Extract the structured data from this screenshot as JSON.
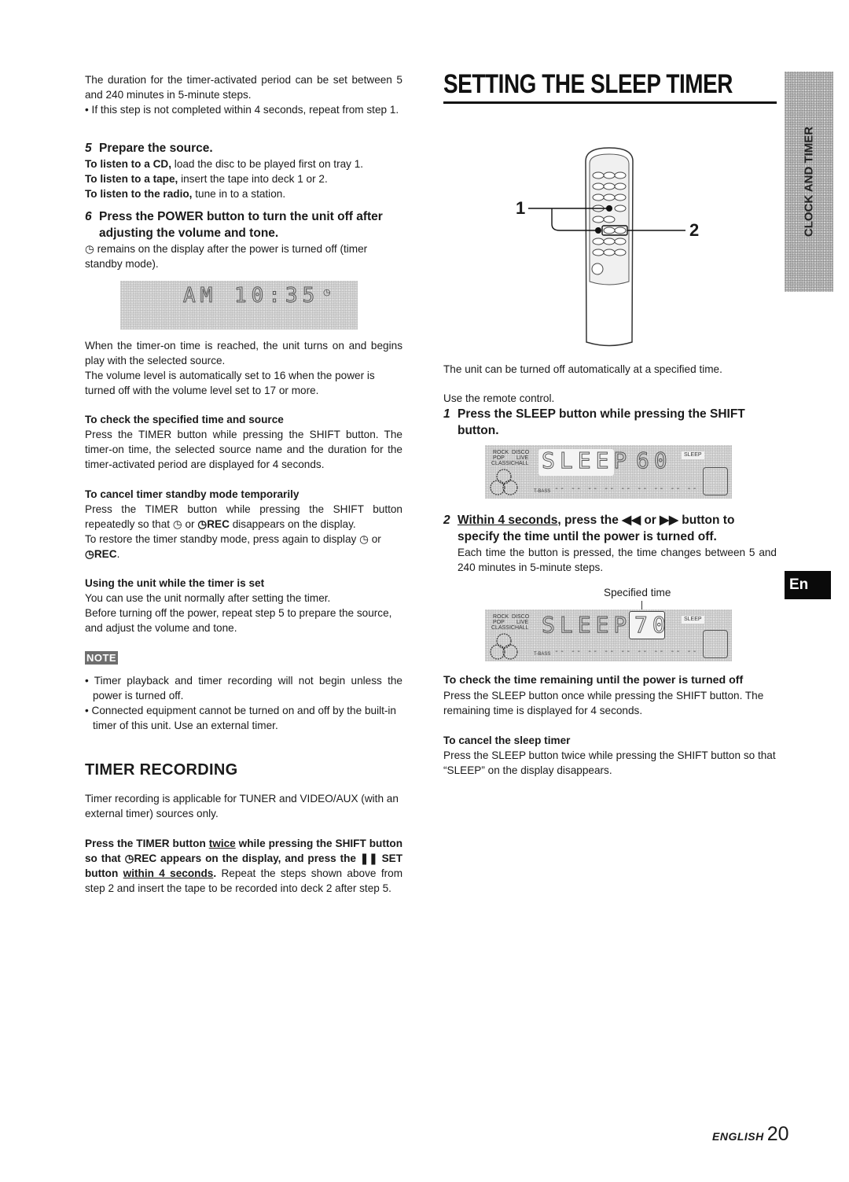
{
  "left_column": {
    "intro": {
      "line1": "The duration for the timer-activated period can be set between 5 and 240 minutes in 5-minute steps.",
      "bullet": "If this step is not completed within 4 seconds, repeat from step 1."
    },
    "step5": {
      "number": "5",
      "title": "Prepare the source.",
      "cd_lead": "To listen to a CD,",
      "cd_text": " load the disc to be played first on tray 1.",
      "tape_lead": "To listen to a tape,",
      "tape_text": " insert the tape into deck 1 or 2.",
      "radio_lead": "To listen to the radio,",
      "radio_text": " tune in to a station."
    },
    "step6": {
      "number": "6",
      "title": "Press the POWER button to turn the unit off after adjusting the volume and tone.",
      "body": "⌚ remains on the display after the power is turned off (timer standby mode).",
      "clock_symbol": "◷",
      "body_text": " remains on the display after the power is turned off (timer standby mode)."
    },
    "display1": {
      "text": "AM 10:35",
      "indicator_icon": "timer-clock-icon",
      "indicator": "◷"
    },
    "after_display": {
      "p1": "When the timer-on time is reached, the unit turns on and begins play with the selected source.",
      "p2": "The volume level is automatically set to 16 when the power is turned off with the volume level set to 17 or more."
    },
    "check_time": {
      "heading": "To check the specified time and source",
      "body": "Press the TIMER button while pressing the SHIFT button. The timer-on time, the selected source name and the duration for the timer-activated period are displayed for 4 seconds."
    },
    "cancel_standby": {
      "heading": "To cancel timer standby mode temporarily",
      "body1_a": "Press the TIMER button while pressing the SHIFT button repeatedly so that ",
      "clock": "◷",
      "body1_b": " or ",
      "rec": "◷REC",
      "body1_c": " disappears on the display.",
      "body2_a": "To restore the timer standby mode, press again to display ",
      "body2_b": " or ",
      "body2_c": "."
    },
    "using_unit": {
      "heading": "Using the unit while the timer is set",
      "body1": "You can use the unit normally after setting the timer.",
      "body2": "Before turning off the power, repeat step 5 to prepare the source, and adjust the volume and tone."
    },
    "note": {
      "badge": "NOTE",
      "items": [
        "Timer playback and timer recording will not begin unless the power is turned off.",
        "Connected equipment cannot be turned on and off by the built-in timer of this unit.  Use an external timer."
      ]
    },
    "timer_recording": {
      "title": "TIMER RECORDING",
      "intro": "Timer recording is applicable for TUNER and VIDEO/AUX (with an external timer) sources only.",
      "inst_a": "Press the TIMER button ",
      "inst_twice": "twice",
      "inst_b": " while pressing the SHIFT button so that ",
      "inst_rec": "◷REC",
      "inst_c": " appears on the display, and press the ",
      "inst_pause": "❚❚",
      "inst_d": " SET button ",
      "inst_within": "within 4 seconds",
      "inst_e": ".",
      "inst_rest": "  Repeat the steps shown above from step 2 and insert the tape to be recorded into deck 2 after step 5."
    }
  },
  "right_column": {
    "title": "SETTING THE SLEEP TIMER",
    "callouts": {
      "one": "1",
      "two": "2"
    },
    "intro": "The unit can be turned off automatically at a specified time.",
    "use_remote": "Use the remote control.",
    "step1": {
      "number": "1",
      "title": "Press the SLEEP button while pressing the SHIFT button."
    },
    "display2": {
      "eq_labels": [
        "ROCK",
        "DISCO",
        "POP",
        "LIVE",
        "CLASSIC",
        "HALL"
      ],
      "main": "SLEEP",
      "value": "60",
      "badge": "SLEEP",
      "tbass": "T-BASS"
    },
    "step2": {
      "number": "2",
      "title_underlined": "Within 4 seconds",
      "title_a": ", press the ",
      "rewind": "◀◀",
      "title_b": " or ",
      "forward": "▶▶",
      "title_c": " button to specify the time until the power is turned off.",
      "body": "Each time the button is pressed, the time changes between 5 and 240 minutes in 5-minute steps."
    },
    "specified_time_label": "Specified time",
    "display3": {
      "eq_labels": [
        "ROCK",
        "DISCO",
        "POP",
        "LIVE",
        "CLASSIC",
        "HALL"
      ],
      "main": "SLEEP",
      "value": "70",
      "badge": "SLEEP",
      "tbass": "T-BASS"
    },
    "check_remaining": {
      "heading": "To check the time remaining until the power is turned off",
      "body": "Press the SLEEP button once while pressing the SHIFT button. The remaining time is displayed for 4 seconds."
    },
    "cancel_sleep": {
      "heading": "To cancel the sleep timer",
      "body": "Press the SLEEP button twice while pressing the SHIFT button so that “SLEEP” on the display disappears."
    }
  },
  "side_tab": {
    "label": "CLOCK AND TIMER"
  },
  "language_tab": {
    "label": "En"
  },
  "footer": {
    "language": "ENGLISH",
    "page": "20"
  }
}
